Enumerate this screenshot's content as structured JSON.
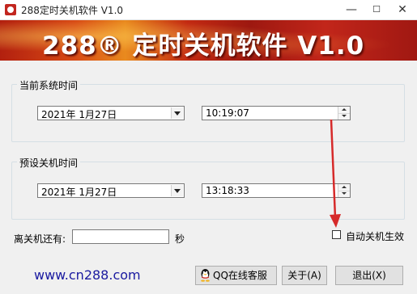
{
  "window": {
    "title": "288定时关机软件 V1.0",
    "minimize": "—",
    "maximize": "☐",
    "close": "✕"
  },
  "banner": {
    "text": "288® 定时关机软件 V1.0"
  },
  "current_time_group": {
    "label": "当前系统时间",
    "date_value": "2021年  1月27日",
    "time_value": "10:19:07"
  },
  "preset_group": {
    "label": "预设关机时间",
    "date_value": "2021年  1月27日",
    "time_value": "13:18:33"
  },
  "countdown": {
    "label": "离关机还有:",
    "value": "",
    "unit": "秒"
  },
  "auto_shutdown": {
    "label": "自动关机生效",
    "checked": false
  },
  "footer": {
    "website": "www.cn288.com",
    "qq_button": "QQ在线客服",
    "about_button": "关于(A)",
    "exit_button": "退出(X)"
  },
  "colors": {
    "annotation_arrow": "#d62a2a",
    "link": "#1a1aa0",
    "banner_red": "#b2200f"
  },
  "icons": {
    "app": "app-icon",
    "qq": "qq-penguin-icon",
    "dropdown": "chevron-down-icon"
  }
}
